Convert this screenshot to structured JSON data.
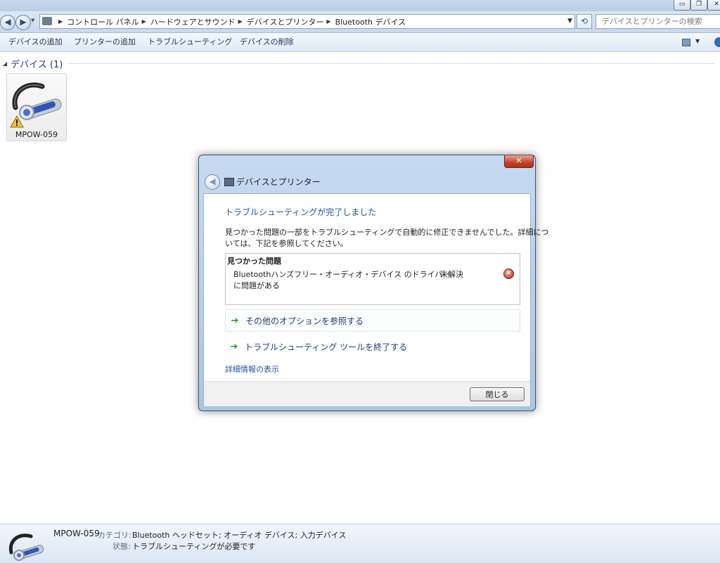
{
  "window": {
    "min_glyph": "▭",
    "max_glyph": "❐",
    "close_glyph": "✕"
  },
  "address_bar": {
    "crumbs": [
      "コントロール パネル",
      "ハードウェアとサウンド",
      "デバイスとプリンター",
      "Bluetooth デバイス"
    ],
    "search_placeholder": "デバイスとプリンターの検索"
  },
  "command_bar": {
    "items": [
      "デバイスの追加",
      "プリンターの追加",
      "トラブルシューティング",
      "デバイスの削除"
    ]
  },
  "content": {
    "group_title": "デバイス (1)",
    "devices": [
      {
        "name": "MPOW-059",
        "icon": "bluetooth-headset-icon",
        "warning_icon": "warning-icon"
      }
    ]
  },
  "details_pane": {
    "device_name": "MPOW-059",
    "category_label": "カテゴリ:",
    "category_value": "Bluetooth ヘッドセット; オーディオ デバイス; 入力デバイス",
    "status_label": "状態:",
    "status_value": "トラブルシューティングが必要です"
  },
  "dialog": {
    "title": "デバイスとプリンター",
    "close_glyph": "✕",
    "heading": "トラブルシューティングが完了しました",
    "description_line1": "見つかった問題の一部をトラブルシューティングで自動的に修正できませんでした。詳細につ",
    "description_line2": "いては、下記を参照してください。",
    "problems_header": "見つかった問題",
    "problem": {
      "line1": "Bluetoothハンズフリー・オーディオ・デバイス のドライバー",
      "line2": "に問題がある",
      "status": "未解決",
      "status_icon": "error-icon"
    },
    "options": [
      "その他のオプションを参照する",
      "トラブルシューティング ツールを終了する"
    ],
    "details_link": "詳細情報の表示",
    "close_button": "閉じる"
  },
  "colors": {
    "accent_blue": "#1f54a0",
    "arrow_green": "#2d9a2d",
    "close_red": "#c6432a"
  }
}
